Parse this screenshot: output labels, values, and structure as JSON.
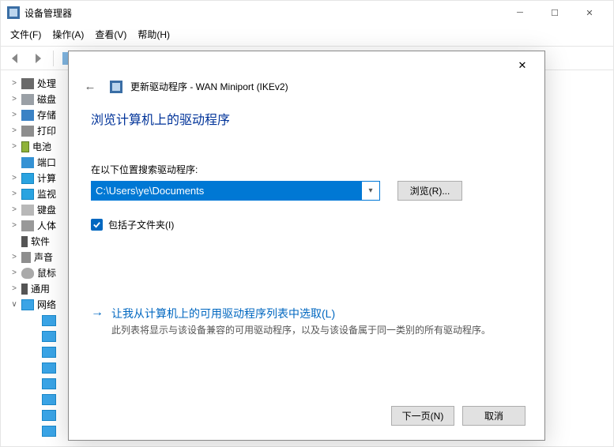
{
  "devman": {
    "title": "设备管理器",
    "menu": {
      "file": "文件(F)",
      "action": "操作(A)",
      "view": "查看(V)",
      "help": "帮助(H)"
    },
    "tree": [
      {
        "t": "处理",
        "ic": "cpu",
        "tw": ">"
      },
      {
        "t": "磁盘",
        "ic": "disk",
        "tw": ">"
      },
      {
        "t": "存储",
        "ic": "store",
        "tw": ">"
      },
      {
        "t": "打印",
        "ic": "prn",
        "tw": ">"
      },
      {
        "t": "电池",
        "ic": "batt",
        "tw": ">"
      },
      {
        "t": "端口",
        "ic": "port",
        "tw": ""
      },
      {
        "t": "计算",
        "ic": "mon",
        "tw": ">"
      },
      {
        "t": "监视",
        "ic": "mon",
        "tw": ">"
      },
      {
        "t": "键盘",
        "ic": "kbd",
        "tw": ">"
      },
      {
        "t": "人体",
        "ic": "hid",
        "tw": ">"
      },
      {
        "t": "软件",
        "ic": "usb",
        "tw": ""
      },
      {
        "t": "声音",
        "ic": "audio",
        "tw": ">"
      },
      {
        "t": "鼠标",
        "ic": "mouse",
        "tw": ">"
      },
      {
        "t": "通用",
        "ic": "usb",
        "tw": ">"
      },
      {
        "t": "网络",
        "ic": "net",
        "tw": "∨"
      }
    ]
  },
  "dialog": {
    "head": "更新驱动程序 - WAN Miniport (IKEv2)",
    "title": "浏览计算机上的驱动程序",
    "search_label": "在以下位置搜索驱动程序:",
    "path_value": "C:\\Users\\ye\\Documents",
    "browse_btn": "浏览(R)...",
    "include_sub": "包括子文件夹(I)",
    "link_title": "让我从计算机上的可用驱动程序列表中选取(L)",
    "link_sub": "此列表将显示与该设备兼容的可用驱动程序，以及与该设备属于同一类别的所有驱动程序。",
    "next_btn": "下一页(N)",
    "cancel_btn": "取消"
  }
}
